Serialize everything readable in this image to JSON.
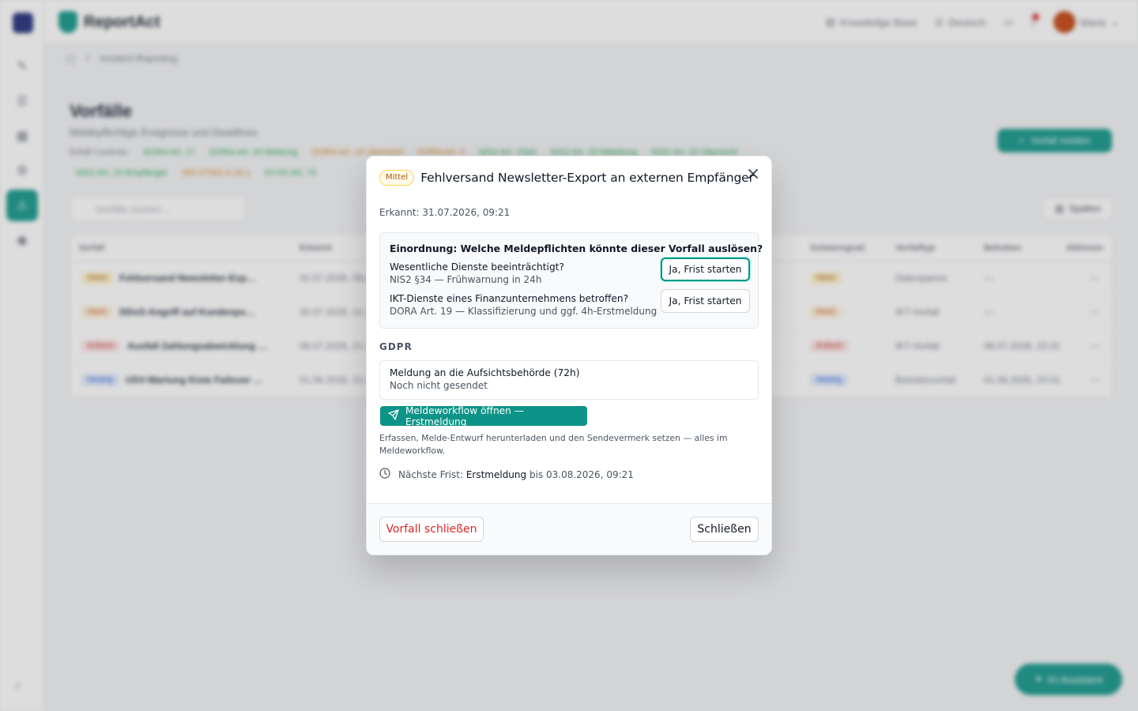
{
  "app": {
    "brand_name": "ReportAct",
    "top_links": [
      "Knowledge Base",
      "Deutsch"
    ],
    "user_name": "Maria",
    "breadcrumb": "Incident Reporting"
  },
  "background": {
    "page_title": "Vorfälle",
    "page_subtitle": "Meldepflichtige Ereignisse und Deadlines",
    "regime_label": "Erfüllt Controls:",
    "regimes_row1": [
      "DORA Art. 17",
      "DORA Art. 19 Meldung",
      "DORA Art. 19 Übersicht",
      "DORA Art. 3",
      "NIS2 Art. 23(4)",
      "NIS2 Art. 23 Mitteilung",
      "NIS2 Art. 23 Übersicht"
    ],
    "regimes_row2": [
      "NIS2 Art. 23 Empfänger",
      "ISO 27001 A.16.1",
      "KI-VO Art. 73"
    ],
    "report_button": "Vorfall melden",
    "search_placeholder": "Vorfälle suchen…",
    "columns_button": "Spalten",
    "table_headers": [
      "Vorfall",
      "Erkannt",
      "Schweregrad",
      "Vorfalltyp",
      "Behoben",
      "Aktionen"
    ],
    "rows": [
      {
        "badge": "Mittel",
        "title": "Fehlversand Newsletter-Exp…",
        "date": "31.07.2026, 09:21",
        "severity": "Mittel",
        "type": "Datenpanne",
        "resolved": "—"
      },
      {
        "badge": "Hoch",
        "title": "DDoS-Angriff auf Kundenpo…",
        "date": "30.07.2026, 21:14",
        "severity": "Hoch",
        "type": "IKT-Vorfall",
        "resolved": "—"
      },
      {
        "badge": "Kritisch",
        "title": "Ausfall Zahlungsabwicklung …",
        "date": "06.07.2026, 21:15",
        "severity": "Kritisch",
        "type": "IKT-Vorfall",
        "resolved": "06.07.2026, 23:31"
      },
      {
        "badge": "Niedrig",
        "title": "USV-Wartung Kiste Failover …",
        "date": "01.06.2026, 21:15",
        "severity": "Niedrig",
        "type": "Betriebsvorfall",
        "resolved": "01.06.2026, 23:31"
      }
    ],
    "ai_button": "KI-Assistent"
  },
  "modal": {
    "severity_badge": "Mittel",
    "title": "Fehlversand Newsletter-Export an externen Empfänger",
    "detected": "Erkannt: 31.07.2026, 09:21",
    "classification": {
      "question": "Einordnung: Welche Meldepflichten könnte dieser Vorfall auslösen?",
      "items": [
        {
          "label": "Wesentliche Dienste beeinträchtigt?",
          "hint": "NIS2 §34 — Frühwarnung in 24h",
          "button": "Ja, Frist starten"
        },
        {
          "label": "IKT-Dienste eines Finanzunternehmens betroffen?",
          "hint": "DORA Art. 19 — Klassifizierung und ggf. 4h-Erstmeldung",
          "button": "Ja, Frist starten"
        }
      ]
    },
    "gdpr": {
      "heading": "GDPR",
      "notice_title": "Meldung an die Aufsichtsbehörde (72h)",
      "notice_status": "Noch nicht gesendet",
      "workflow_button": "Meldeworkflow öffnen — Erstmeldung",
      "workflow_help": "Erfassen, Melde-Entwurf herunterladen und den Sendevermerk setzen — alles im Meldeworkflow.",
      "deadline_prefix": "Nächste Frist:",
      "deadline_type": "Erstmeldung",
      "deadline_suffix": "bis 03.08.2026, 09:21"
    },
    "footer": {
      "close_incident": "Vorfall schließen",
      "close": "Schließen"
    }
  },
  "colors": {
    "accent": "#0d9488",
    "danger": "#dc2626",
    "severity_medium": "#b45309"
  }
}
